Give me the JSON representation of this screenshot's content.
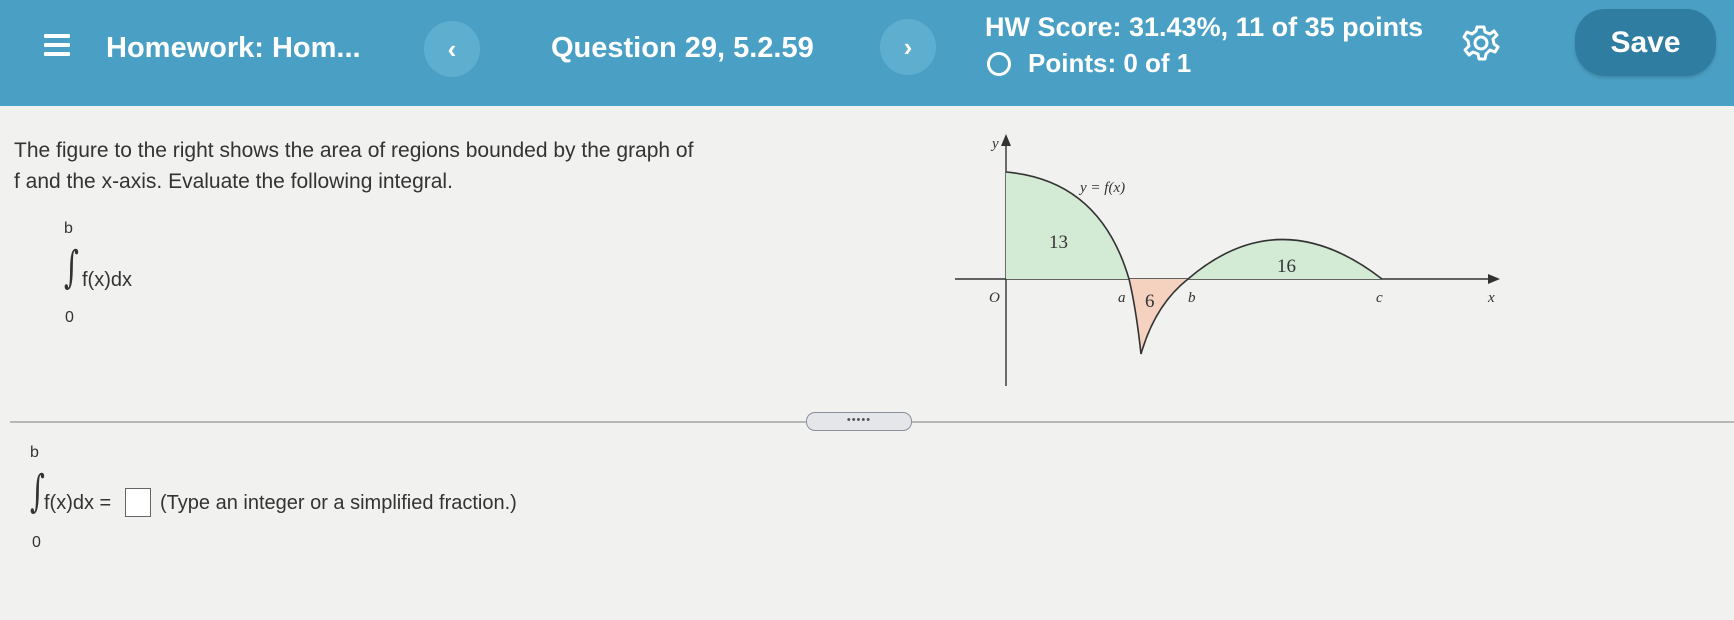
{
  "header": {
    "title": "Homework: Hom...",
    "prev_label": "‹",
    "next_label": "›",
    "question": "Question 29, 5.2.59",
    "hw_score": "HW Score: 31.43%, 11 of 35 points",
    "points": "Points: 0 of 1",
    "save_label": "Save",
    "colors": {
      "bar": "#4aa0c4",
      "save": "#2f7da0"
    }
  },
  "question": {
    "prompt": "The figure to the right shows the area of regions bounded by the graph of f and the x-axis. Evaluate the following integral.",
    "integral": {
      "upper": "b",
      "lower": "0",
      "expression": "f(x)dx"
    }
  },
  "graph": {
    "y_label": "y",
    "x_label": "x",
    "origin_label": "O",
    "function_label": "y = f(x)",
    "point_labels": [
      "a",
      "b",
      "c"
    ],
    "regions": [
      {
        "area": "13",
        "sign": "positive",
        "color": "#d3ead5"
      },
      {
        "area": "6",
        "sign": "negative",
        "color": "#f5d2bf"
      },
      {
        "area": "16",
        "sign": "positive",
        "color": "#d3ead5"
      }
    ]
  },
  "answer": {
    "upper": "b",
    "lower": "0",
    "expression": "f(x)dx =",
    "value": "",
    "hint": "(Type an integer or a simplified fraction.)"
  },
  "divider_handle": "•••••"
}
